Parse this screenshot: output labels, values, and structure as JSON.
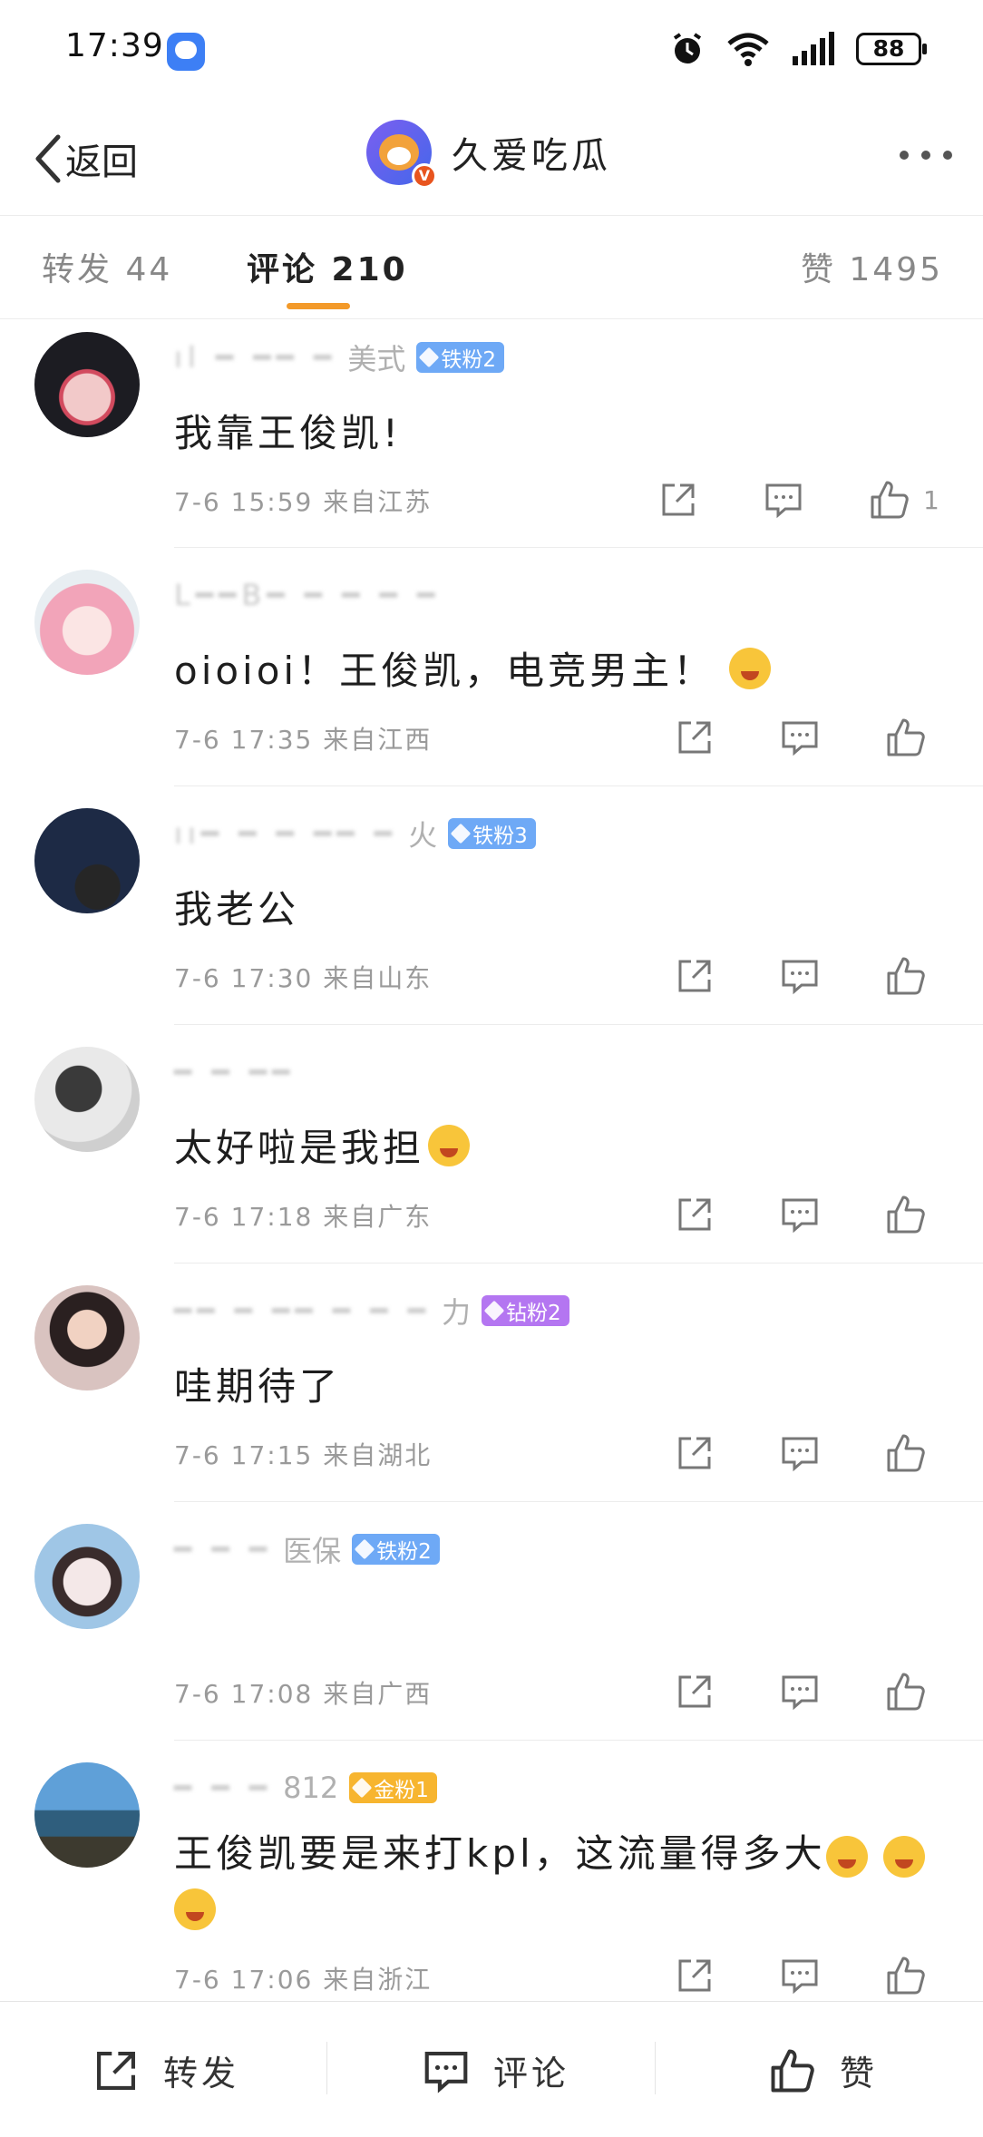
{
  "status_bar": {
    "time": "17:39",
    "battery": "88"
  },
  "nav": {
    "back_label": "返回",
    "account_name": "久爱吃瓜",
    "verified_badge": "V"
  },
  "tabs": {
    "forward": "转发 44",
    "comment": "评论 210",
    "like": "赞 1495"
  },
  "comments": [
    {
      "name_suffix": "美式",
      "badge": "铁粉2",
      "text": "我靠王俊凯!",
      "meta": "7-6 15:59 来自江苏",
      "likes": "1"
    },
    {
      "name_suffix": "",
      "badge": "",
      "text": "oioioi！王俊凯，电竞男主！",
      "meta": "7-6 17:35 来自江西",
      "likes": ""
    },
    {
      "name_suffix": "火",
      "badge": "铁粉3",
      "text": "我老公",
      "meta": "7-6 17:30 来自山东",
      "likes": ""
    },
    {
      "name_suffix": "",
      "badge": "",
      "text": "太好啦是我担",
      "meta": "7-6 17:18 来自广东",
      "likes": ""
    },
    {
      "name_suffix": "力",
      "badge": "钻粉2",
      "text": "哇期待了",
      "meta": "7-6 17:15 来自湖北",
      "likes": ""
    },
    {
      "name_suffix": "医保",
      "badge": "铁粉2",
      "text": "",
      "meta": "7-6 17:08 来自广西",
      "likes": ""
    },
    {
      "name_suffix": "812",
      "badge": "金粉1",
      "text": "王俊凯要是来打kpl，这流量得多大",
      "meta": "7-6 17:06 来自浙江",
      "likes": ""
    }
  ],
  "bottom_bar": {
    "forward": "转发",
    "comment": "评论",
    "like": "赞"
  },
  "colors": {
    "accent": "#f39a2a",
    "badge_iron": "#6ea9f6",
    "badge_diamond": "#b476f1",
    "badge_gold": "#f7b52f"
  },
  "icons": [
    "back-chevron-icon",
    "more-icon",
    "share-icon",
    "comment-icon",
    "thumb-up-icon",
    "alarm-icon",
    "wifi-icon",
    "signal-icon"
  ]
}
